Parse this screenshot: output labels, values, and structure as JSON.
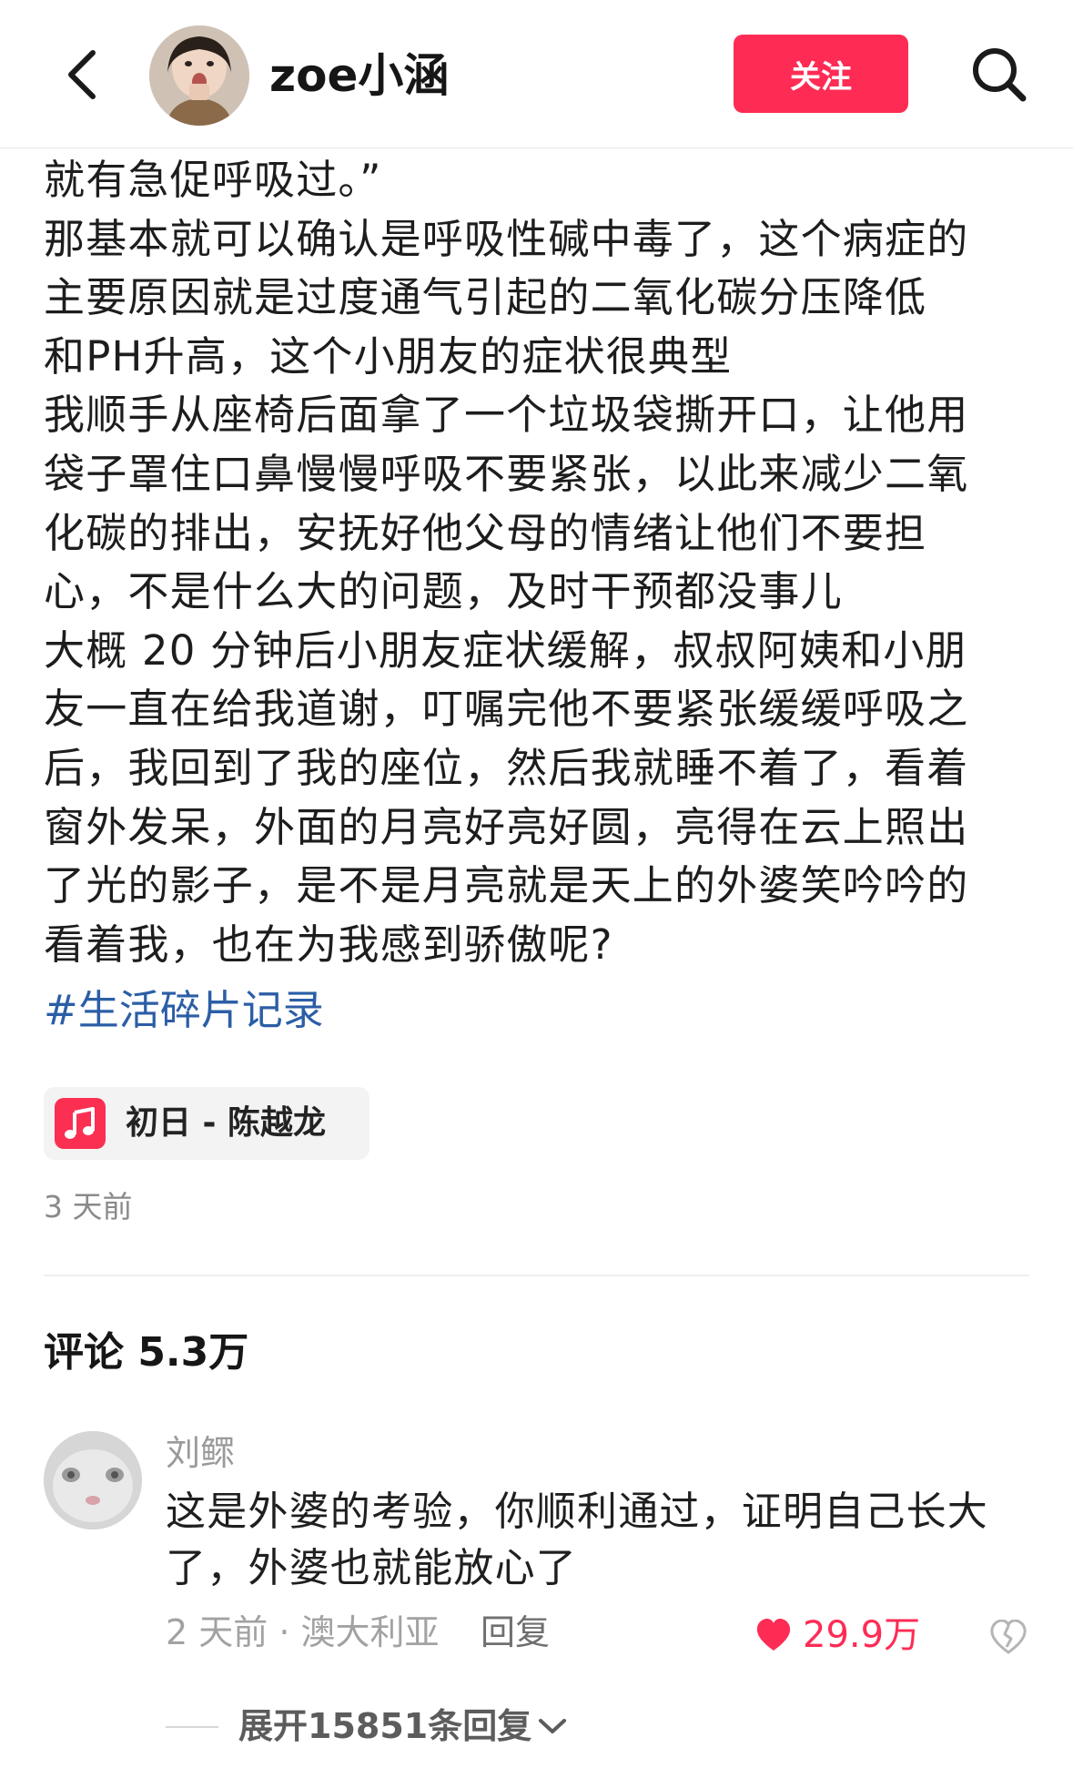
{
  "header": {
    "username": "zoe小涵",
    "follow_label": "关注"
  },
  "post": {
    "lines": [
      "就有急促呼吸过。”",
      "那基本就可以确认是呼吸性碱中毒了，这个病症的",
      "主要原因就是过度通气引起的二氧化碳分压降低",
      "和PH升高，这个小朋友的症状很典型",
      "我顺手从座椅后面拿了一个垃圾袋撕开口，让他用",
      "袋子罩住口鼻慢慢呼吸不要紧张，以此来减少二氧",
      "化碳的排出，安抚好他父母的情绪让他们不要担",
      "心，不是什么大的问题，及时干预都没事儿",
      "大概 20 分钟后小朋友症状缓解，叔叔阿姨和小朋",
      "友一直在给我道谢，叮嘱完他不要紧张缓缓呼吸之",
      "后，我回到了我的座位，然后我就睡不着了，看着",
      "窗外发呆，外面的月亮好亮好圆，亮得在云上照出",
      "了光的影子，是不是月亮就是天上的外婆笑吟吟的",
      "看着我，也在为我感到骄傲呢?"
    ],
    "hashtag": "#生活碎片记录",
    "music": "初日 - 陈越龙",
    "time": "3 天前"
  },
  "comments_section": {
    "heading": "评论 5.3万"
  },
  "comment": {
    "author": "刘鳏",
    "lines": [
      "这是外婆的考验，你顺利通过，证明自己长大",
      "了，外婆也就能放心了"
    ],
    "meta": "2 天前 · 澳大利亚",
    "reply_label": "回复",
    "likes": "29.9万",
    "expand_label": "展开15851条回复"
  },
  "colors": {
    "accent": "#fe2c55",
    "hashtag": "#2b5ea6",
    "muted": "#9a9a9a"
  },
  "icons": {
    "back": "chevron-left-icon",
    "search": "search-icon",
    "music": "music-note-icon",
    "like": "heart-filled-icon",
    "dislike": "broken-heart-icon",
    "expand": "chevron-down-icon"
  }
}
